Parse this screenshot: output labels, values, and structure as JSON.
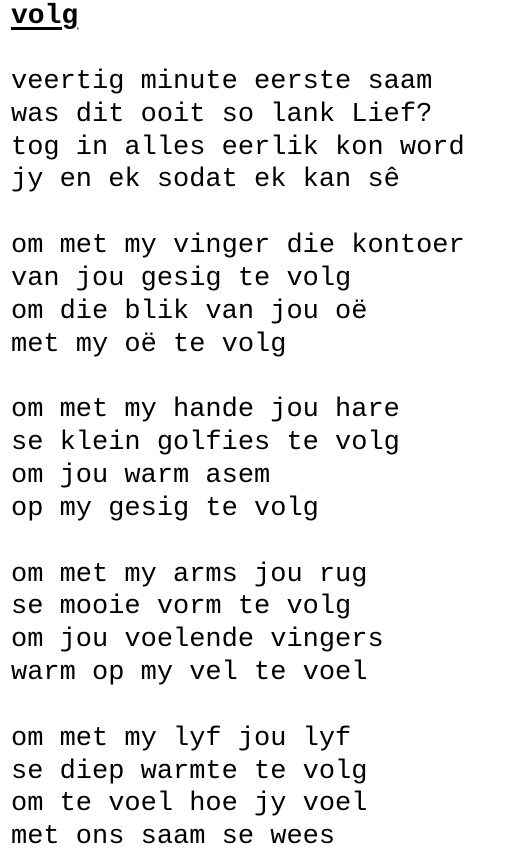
{
  "poem": {
    "title": "volg",
    "stanzas": [
      {
        "lines": [
          "veertig minute eerste saam",
          "was dit ooit so lank Lief?",
          "tog in alles eerlik kon word",
          "jy en ek sodat ek kan sê"
        ]
      },
      {
        "lines": [
          "om met my vinger die kontoer",
          "van jou gesig te volg",
          "om die blik van jou oë",
          "met my oë te volg"
        ]
      },
      {
        "lines": [
          "om met my hande jou hare",
          "se klein golfies te volg",
          "om jou warm asem",
          "op my gesig te volg"
        ]
      },
      {
        "lines": [
          "om met my arms jou rug",
          "se mooie vorm te volg",
          "om jou voelende vingers",
          "warm op my vel te voel"
        ]
      },
      {
        "lines": [
          "om met my lyf jou lyf",
          "se diep warmte te volg",
          "om te voel hoe jy voel",
          "met ons saam se wees"
        ]
      }
    ]
  }
}
